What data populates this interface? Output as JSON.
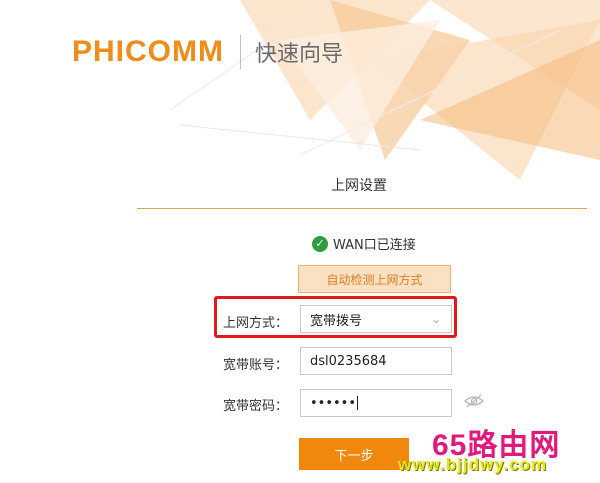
{
  "header": {
    "logo": "PHICOMM",
    "title": "快速向导"
  },
  "section": {
    "title": "上网设置"
  },
  "wan_status": {
    "text": "WAN口已连接",
    "icon": "check-circle-icon"
  },
  "detect_button": {
    "label": "自动检测上网方式"
  },
  "form": {
    "connection_type": {
      "label": "上网方式：",
      "value": "宽带拨号"
    },
    "account": {
      "label": "宽带账号：",
      "value": "dsl0235684"
    },
    "password": {
      "label": "宽带密码：",
      "value": "••••••"
    }
  },
  "next_button": {
    "label": "下一步"
  },
  "watermark": {
    "brand": "65路由网",
    "url": "www.bjjdwy.com"
  },
  "colors": {
    "accent": "#f0880e",
    "highlight": "#e11b1b",
    "success": "#2e9c3f"
  }
}
